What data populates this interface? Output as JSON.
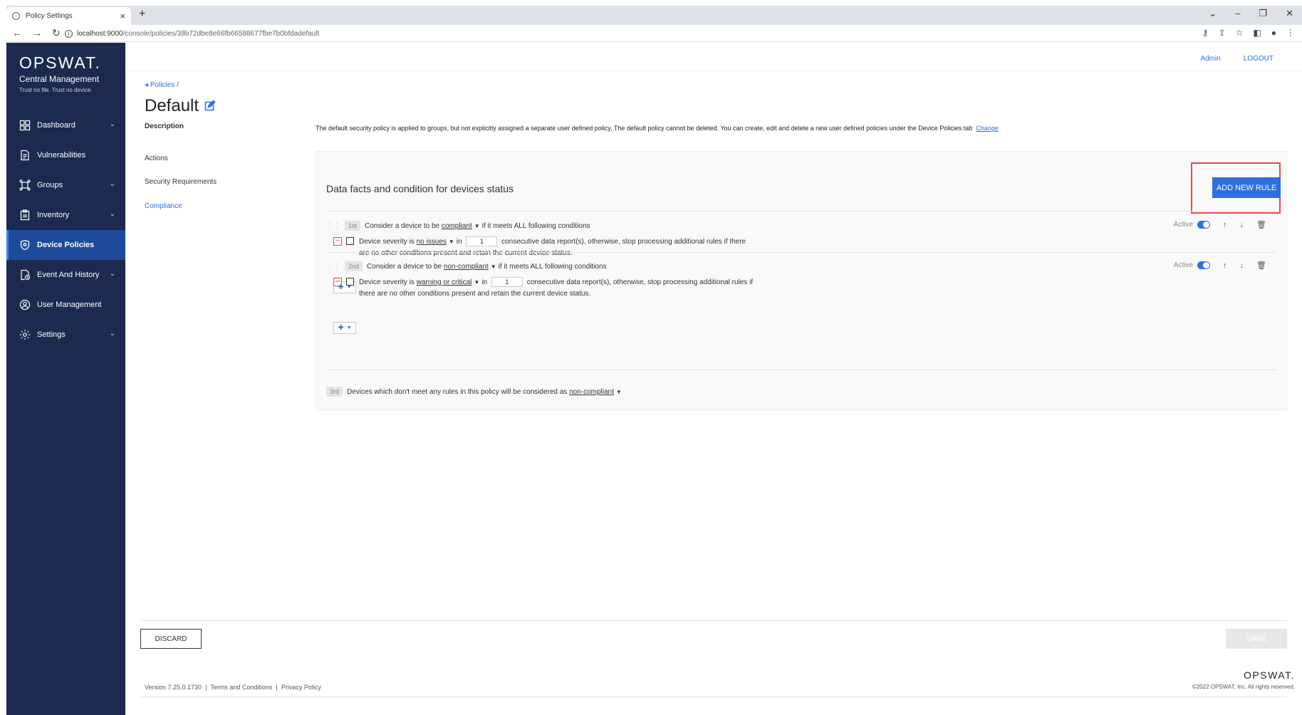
{
  "browser": {
    "tab_title": "Policy Settings",
    "tab_close": "×",
    "new_tab": "+",
    "url_host": "localhost:9000",
    "url_path": "/console/policies/38b72dbe8e66fb66588677fbe7b0bfdadefault"
  },
  "sidebar": {
    "logo": "OPSWAT.",
    "subtitle": "Central Management",
    "tagline": "Trust no file. Trust no device.",
    "items": [
      {
        "label": "Dashboard",
        "icon": "grid-icon",
        "has_chevron": true
      },
      {
        "label": "Vulnerabilities",
        "icon": "document-icon",
        "has_chevron": false
      },
      {
        "label": "Groups",
        "icon": "groups-icon",
        "has_chevron": true
      },
      {
        "label": "Inventory",
        "icon": "clipboard-icon",
        "has_chevron": true
      },
      {
        "label": "Device Policies",
        "icon": "shield-icon",
        "has_chevron": false,
        "active": true
      },
      {
        "label": "Event And History",
        "icon": "history-icon",
        "has_chevron": true
      },
      {
        "label": "User Management",
        "icon": "user-icon",
        "has_chevron": false
      },
      {
        "label": "Settings",
        "icon": "gear-icon",
        "has_chevron": true
      }
    ]
  },
  "header": {
    "admin_label": "Admin",
    "logout_label": "LOGOUT"
  },
  "page": {
    "breadcrumb": "Policies /",
    "title": "Default",
    "sections": {
      "description": "Description",
      "actions": "Actions",
      "security": "Security Requirements",
      "compliance": "Compliance"
    },
    "description_text": "The default security policy is applied to groups, but not explicitly assigned a separate user defined policy. The default policy cannot be deleted. You can create, edit and delete a new user defined policies under the Device Policies tab",
    "change_link": "Change"
  },
  "compliance": {
    "panel_title": "Data facts and condition for devices status",
    "add_rule_label": "ADD NEW RULE",
    "active_label": "Active",
    "rules": [
      {
        "rank": "1st",
        "prefix": "Consider a device to be",
        "status": "compliant",
        "suffix": "if it meets ALL following conditions",
        "cond_prefix": "Device severity is",
        "severity": "no issues",
        "cond_in": "in",
        "count": "1",
        "cond_suffix": "consecutive data report(s), otherwise, stop processing additional rules if there are no other conditions present and retain the current device status."
      },
      {
        "rank": "2nd",
        "prefix": "Consider a device to be",
        "status": "non-compliant",
        "suffix": "if it meets ALL following conditions",
        "cond_prefix": "Device severity is",
        "severity": "warning or critical",
        "cond_in": "in",
        "count": "1",
        "cond_suffix": "consecutive data report(s), otherwise, stop processing additional rules if there are no other conditions present and retain the current device status."
      }
    ],
    "final_rank": "3rd",
    "final_text": "Devices which don't meet any rules in this policy will be considered as",
    "final_status": "non-compliant"
  },
  "actions": {
    "discard_label": "DISCARD",
    "save_label": "SAVE"
  },
  "footer": {
    "version": "Version 7.25.0.1730",
    "terms": "Terms and Conditions",
    "privacy": "Privacy Policy",
    "sep": "|",
    "brand": "OPSWAT.",
    "copyright": "©2022 OPSWAT, Inc. All rights reserved."
  },
  "colors": {
    "sidebar_bg": "#1b2a4e",
    "active_bg": "#1e4a9a",
    "accent": "#2f6fe0",
    "highlight": "#e5484d"
  }
}
